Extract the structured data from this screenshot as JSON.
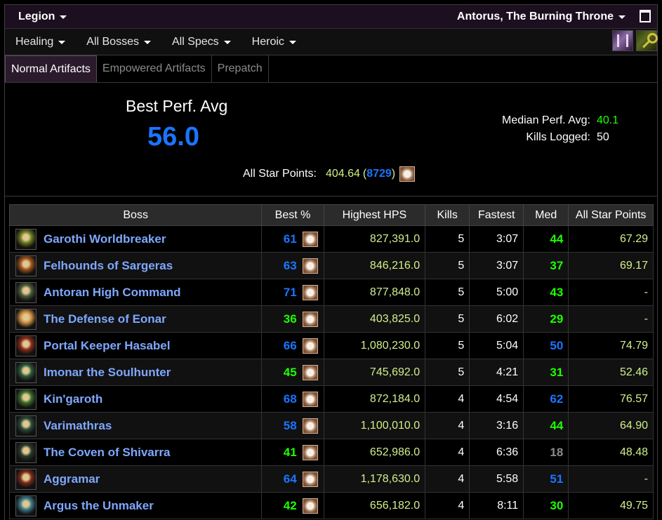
{
  "topbar": {
    "expansion": "Legion",
    "zone": "Antorus, The Burning Throne"
  },
  "filters": [
    "Healing",
    "All Bosses",
    "All Specs",
    "Heroic"
  ],
  "tabs": [
    {
      "label": "Normal Artifacts",
      "active": true
    },
    {
      "label": "Empowered Artifacts",
      "active": false
    },
    {
      "label": "Prepatch",
      "active": false
    }
  ],
  "summary": {
    "best_label": "Best Perf. Avg",
    "best_value": "56.0",
    "median_label": "Median Perf. Avg:",
    "median_value": "40.1",
    "kills_label": "Kills Logged:",
    "kills_value": "50",
    "star_label": "All Star Points:",
    "star_value": "404.64",
    "star_open": "(",
    "star_rank": "8729",
    "star_close": ")"
  },
  "table": {
    "headers": [
      "Boss",
      "Best %",
      "Highest HPS",
      "Kills",
      "Fastest",
      "Med",
      "All Star Points"
    ],
    "rows": [
      {
        "boss": "Garothi Worldbreaker",
        "best": "61",
        "best_color": "blue",
        "hps": "827,391.0",
        "kills": "5",
        "fastest": "3:07",
        "med": "44",
        "med_color": "green",
        "asp": "67.29"
      },
      {
        "boss": "Felhounds of Sargeras",
        "best": "63",
        "best_color": "blue",
        "hps": "846,216.0",
        "kills": "5",
        "fastest": "3:07",
        "med": "37",
        "med_color": "green",
        "asp": "69.17"
      },
      {
        "boss": "Antoran High Command",
        "best": "71",
        "best_color": "blue",
        "hps": "877,848.0",
        "kills": "5",
        "fastest": "5:00",
        "med": "43",
        "med_color": "green",
        "asp": "-"
      },
      {
        "boss": "The Defense of Eonar",
        "best": "36",
        "best_color": "green",
        "hps": "403,825.0",
        "kills": "5",
        "fastest": "6:02",
        "med": "29",
        "med_color": "green",
        "asp": "-"
      },
      {
        "boss": "Portal Keeper Hasabel",
        "best": "66",
        "best_color": "blue",
        "hps": "1,080,230.0",
        "kills": "5",
        "fastest": "5:04",
        "med": "50",
        "med_color": "blue",
        "asp": "74.79"
      },
      {
        "boss": "Imonar the Soulhunter",
        "best": "45",
        "best_color": "green",
        "hps": "745,692.0",
        "kills": "5",
        "fastest": "4:21",
        "med": "31",
        "med_color": "green",
        "asp": "52.46"
      },
      {
        "boss": "Kin'garoth",
        "best": "68",
        "best_color": "blue",
        "hps": "872,184.0",
        "kills": "4",
        "fastest": "4:54",
        "med": "62",
        "med_color": "blue",
        "asp": "76.57"
      },
      {
        "boss": "Varimathras",
        "best": "58",
        "best_color": "blue",
        "hps": "1,100,010.0",
        "kills": "4",
        "fastest": "3:16",
        "med": "44",
        "med_color": "green",
        "asp": "64.90"
      },
      {
        "boss": "The Coven of Shivarra",
        "best": "41",
        "best_color": "green",
        "hps": "652,986.0",
        "kills": "4",
        "fastest": "6:36",
        "med": "18",
        "med_color": "grey",
        "asp": "48.48"
      },
      {
        "boss": "Aggramar",
        "best": "64",
        "best_color": "blue",
        "hps": "1,178,630.0",
        "kills": "4",
        "fastest": "5:58",
        "med": "51",
        "med_color": "blue",
        "asp": "-"
      },
      {
        "boss": "Argus the Unmaker",
        "best": "42",
        "best_color": "green",
        "hps": "656,182.0",
        "kills": "4",
        "fastest": "8:11",
        "med": "30",
        "med_color": "green",
        "asp": "49.75"
      }
    ]
  },
  "colors": {
    "blue": "#1a75ff",
    "green": "#1eff00",
    "grey": "#8a8a8a",
    "boss_link": "#7ea8ff",
    "points": "#d0f08a"
  },
  "portrait_colors": [
    "#6b7a20",
    "#a0521c",
    "#4a5a3a",
    "#c88a40",
    "#8a2a1a",
    "#2a5a3a",
    "#3a6a2a",
    "#2a4a3a",
    "#2a3a2a",
    "#7a2a1a",
    "#3a7a8a"
  ]
}
